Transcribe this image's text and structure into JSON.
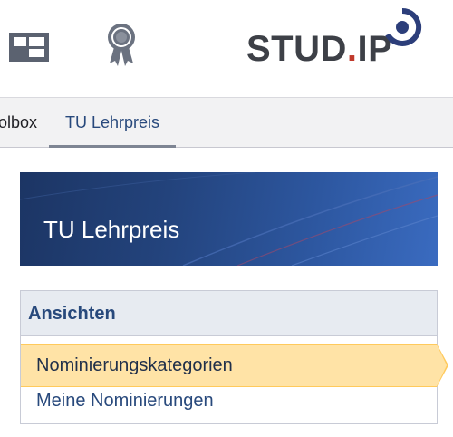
{
  "header": {
    "icons": [
      "tiles-icon",
      "award-ribbon-icon"
    ],
    "logo": {
      "text_main": "STUD",
      "text_dot": ".",
      "text_end": "IP"
    }
  },
  "tabs": [
    {
      "label": "olbox",
      "active": false
    },
    {
      "label": "TU Lehrpreis",
      "active": true
    }
  ],
  "banner": {
    "title": "TU Lehrpreis"
  },
  "sidebar": {
    "heading": "Ansichten",
    "items": [
      {
        "label": "Nominierungskategorien",
        "selected": true
      },
      {
        "label": "Meine Nominierungen",
        "selected": false
      }
    ]
  },
  "colors": {
    "brand_blue": "#28497c",
    "logo_red": "#c0392b",
    "selection_yellow": "#ffe3a6",
    "selection_border": "#ffca5c"
  }
}
